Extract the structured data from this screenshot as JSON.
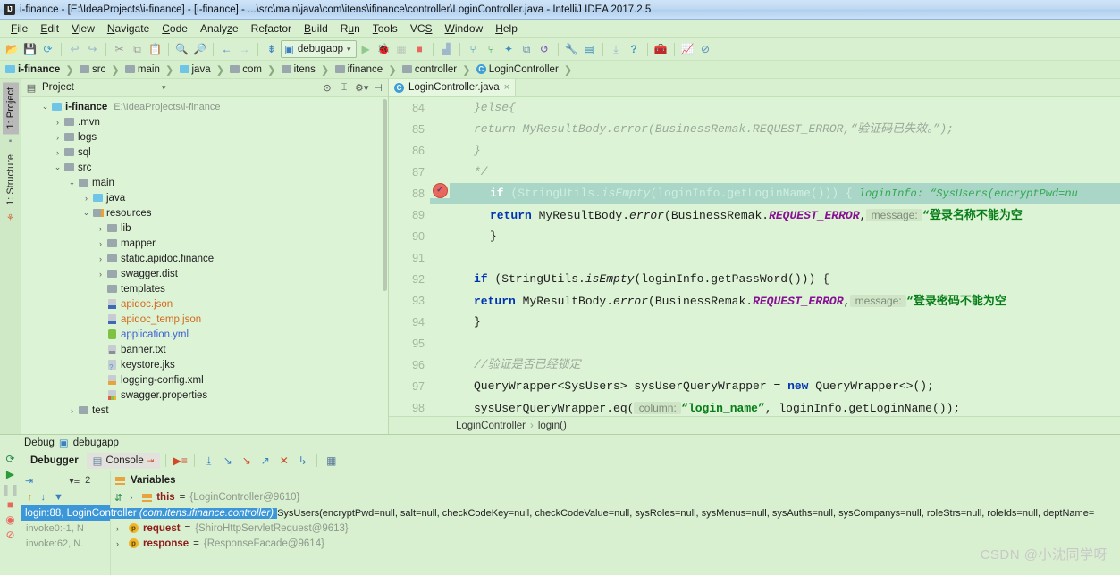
{
  "window": {
    "title": "i-finance - [E:\\IdeaProjects\\i-finance] - [i-finance] - ...\\src\\main\\java\\com\\itens\\ifinance\\controller\\LoginController.java - IntelliJ IDEA 2017.2.5",
    "logo": "IJ"
  },
  "menubar": [
    {
      "label": "File"
    },
    {
      "label": "Edit"
    },
    {
      "label": "View"
    },
    {
      "label": "Navigate"
    },
    {
      "label": "Code"
    },
    {
      "label": "Analyze"
    },
    {
      "label": "Refactor"
    },
    {
      "label": "Build"
    },
    {
      "label": "Run"
    },
    {
      "label": "Tools"
    },
    {
      "label": "VCS"
    },
    {
      "label": "Window"
    },
    {
      "label": "Help"
    }
  ],
  "toolbar": {
    "run_config": "debugapp",
    "icons": [
      "open-folder-icon",
      "save-all-icon",
      "sync-icon",
      "undo-icon",
      "redo-icon",
      "cut-icon",
      "copy-icon",
      "paste-icon",
      "find-icon",
      "replace-icon",
      "back-icon",
      "forward-icon",
      "compile-icon"
    ],
    "run_icons": [
      "run-icon",
      "debug-icon",
      "run-coverage-icon",
      "stop-icon",
      "profile-icon"
    ],
    "vcs_icons": [
      "update-project-icon",
      "commit-icon",
      "push-icon",
      "diff-icon",
      "rollback-icon"
    ],
    "right_icons": [
      "settings-icon",
      "project-structure-icon",
      "sdk-icon",
      "help-icon",
      "toolbox-icon",
      "monitor-icon",
      "no-access-icon"
    ]
  },
  "breadcrumbs": [
    {
      "label": "i-finance",
      "icon": "module-icon",
      "bold": true
    },
    {
      "label": "src",
      "icon": "folder-icon"
    },
    {
      "label": "main",
      "icon": "folder-icon"
    },
    {
      "label": "java",
      "icon": "source-folder-icon"
    },
    {
      "label": "com",
      "icon": "folder-icon"
    },
    {
      "label": "itens",
      "icon": "folder-icon"
    },
    {
      "label": "ifinance",
      "icon": "folder-icon"
    },
    {
      "label": "controller",
      "icon": "folder-icon"
    },
    {
      "label": "LoginController",
      "icon": "class-icon"
    }
  ],
  "left_strip": [
    {
      "label": "1: Project",
      "active": true
    },
    {
      "label": "1: Structure",
      "active": false
    }
  ],
  "project_panel": {
    "title": "Project",
    "header_icons": [
      "locate-icon",
      "collapse-all-icon",
      "gear-icon",
      "hide-icon"
    ],
    "tree": [
      {
        "indent": 0,
        "arrow": "down",
        "icon": "module-icon",
        "label": "i-finance",
        "bold": true,
        "path": "E:\\IdeaProjects\\i-finance"
      },
      {
        "indent": 1,
        "arrow": "right",
        "icon": "folder-icon",
        "label": ".mvn"
      },
      {
        "indent": 1,
        "arrow": "right",
        "icon": "folder-icon",
        "label": "logs"
      },
      {
        "indent": 1,
        "arrow": "right",
        "icon": "folder-icon",
        "label": "sql"
      },
      {
        "indent": 1,
        "arrow": "down",
        "icon": "folder-icon",
        "label": "src"
      },
      {
        "indent": 2,
        "arrow": "down",
        "icon": "folder-icon",
        "label": "main"
      },
      {
        "indent": 3,
        "arrow": "right",
        "icon": "source-folder-icon",
        "label": "java"
      },
      {
        "indent": 3,
        "arrow": "down",
        "icon": "resource-folder-icon",
        "label": "resources"
      },
      {
        "indent": 4,
        "arrow": "right",
        "icon": "folder-icon",
        "label": "lib"
      },
      {
        "indent": 4,
        "arrow": "right",
        "icon": "folder-icon",
        "label": "mapper"
      },
      {
        "indent": 4,
        "arrow": "right",
        "icon": "folder-icon",
        "label": "static.apidoc.finance"
      },
      {
        "indent": 4,
        "arrow": "right",
        "icon": "folder-icon",
        "label": "swagger.dist"
      },
      {
        "indent": 4,
        "arrow": "none",
        "icon": "folder-icon",
        "label": "templates"
      },
      {
        "indent": 4,
        "arrow": "none",
        "icon": "json-file-icon",
        "label": "apidoc.json",
        "color": "orange"
      },
      {
        "indent": 4,
        "arrow": "none",
        "icon": "json-file-icon",
        "label": "apidoc_temp.json",
        "color": "orange"
      },
      {
        "indent": 4,
        "arrow": "none",
        "icon": "yml-file-icon",
        "label": "application.yml",
        "color": "blue"
      },
      {
        "indent": 4,
        "arrow": "none",
        "icon": "txt-file-icon",
        "label": "banner.txt"
      },
      {
        "indent": 4,
        "arrow": "none",
        "icon": "jks-file-icon",
        "label": "keystore.jks"
      },
      {
        "indent": 4,
        "arrow": "none",
        "icon": "xml-file-icon",
        "label": "logging-config.xml"
      },
      {
        "indent": 4,
        "arrow": "none",
        "icon": "properties-file-icon",
        "label": "swagger.properties"
      },
      {
        "indent": 2,
        "arrow": "right",
        "icon": "folder-icon",
        "label": "test"
      }
    ]
  },
  "editor": {
    "tab": {
      "label": "LoginController.java",
      "icon": "class-icon",
      "close": "×"
    },
    "first_line": 84,
    "current_line": 88,
    "breakpoint_line": 88,
    "lines": [
      {
        "num": 84,
        "tokens": [
          {
            "t": "        }else{",
            "c": "cmt"
          }
        ]
      },
      {
        "num": 85,
        "tokens": [
          {
            "t": "            return MyResultBody.error(BusinessRemak.REQUEST_ERROR,“验证码已失效。”);",
            "c": "cmt"
          }
        ]
      },
      {
        "num": 86,
        "tokens": [
          {
            "t": "        }",
            "c": "cmt"
          }
        ]
      },
      {
        "num": 87,
        "tokens": [
          {
            "t": "        */",
            "c": "cmt"
          }
        ]
      },
      {
        "num": 88,
        "current": true,
        "breakpoint": true,
        "tokens": [
          {
            "t": "if ",
            "c": "kw-l"
          },
          {
            "t": "(StringUtils.",
            "c": "plain-l"
          },
          {
            "t": "isEmpty",
            "c": "mth-l"
          },
          {
            "t": "(loginInfo.getLoginName())) {",
            "c": "plain-l"
          },
          {
            "t": "  loginInfo:  “SysUsers(encryptPwd=nu",
            "c": "hint-inline"
          }
        ]
      },
      {
        "num": 89,
        "tokens": [
          {
            "t": "    return ",
            "c": "kw"
          },
          {
            "t": "MyResultBody.",
            "c": "plain"
          },
          {
            "t": "error",
            "c": "mth"
          },
          {
            "t": "(BusinessRemak.",
            "c": "plain"
          },
          {
            "t": "REQUEST_ERROR",
            "c": "cst"
          },
          {
            "t": ",",
            "c": "plain"
          },
          {
            "t": " message: ",
            "c": "hint"
          },
          {
            "t": "“登录名称不能为空",
            "c": "str"
          }
        ]
      },
      {
        "num": 90,
        "tokens": [
          {
            "t": "    }",
            "c": "plain"
          }
        ]
      },
      {
        "num": 91,
        "tokens": []
      },
      {
        "num": 92,
        "tokens": [
          {
            "t": "    if ",
            "c": "kw"
          },
          {
            "t": "(StringUtils.",
            "c": "plain"
          },
          {
            "t": "isEmpty",
            "c": "mth"
          },
          {
            "t": "(loginInfo.getPassWord())) {",
            "c": "plain"
          }
        ]
      },
      {
        "num": 93,
        "tokens": [
          {
            "t": "        return ",
            "c": "kw"
          },
          {
            "t": "MyResultBody.",
            "c": "plain"
          },
          {
            "t": "error",
            "c": "mth"
          },
          {
            "t": "(BusinessRemak.",
            "c": "plain"
          },
          {
            "t": "REQUEST_ERROR",
            "c": "cst"
          },
          {
            "t": ",",
            "c": "plain"
          },
          {
            "t": " message: ",
            "c": "hint"
          },
          {
            "t": "“登录密码不能为空",
            "c": "str"
          }
        ]
      },
      {
        "num": 94,
        "tokens": [
          {
            "t": "    }",
            "c": "plain"
          }
        ]
      },
      {
        "num": 95,
        "tokens": []
      },
      {
        "num": 96,
        "tokens": [
          {
            "t": "    //验证是否已经锁定",
            "c": "cmt"
          }
        ]
      },
      {
        "num": 97,
        "tokens": [
          {
            "t": "    QueryWrapper<SysUsers> sysUserQueryWrapper = ",
            "c": "plain"
          },
          {
            "t": "new ",
            "c": "kw"
          },
          {
            "t": "QueryWrapper<>();",
            "c": "plain"
          }
        ]
      },
      {
        "num": 98,
        "tokens": [
          {
            "t": "    sysUserQueryWrapper.eq(",
            "c": "plain"
          },
          {
            "t": " column: ",
            "c": "hint"
          },
          {
            "t": "“login_name”",
            "c": "str"
          },
          {
            "t": ", loginInfo.getLoginName());",
            "c": "plain"
          }
        ]
      }
    ],
    "status_breadcrumb": [
      {
        "label": "LoginController"
      },
      {
        "label": "login()"
      }
    ]
  },
  "debug": {
    "header": {
      "label": "Debug",
      "config": "debugapp",
      "icon": "debug-config-icon"
    },
    "side_icons": [
      "rerun-icon",
      "resume-icon",
      "pause-icon",
      "stop-icon",
      "view-breakpoints-icon",
      "mute-breakpoints-icon"
    ],
    "tabs": [
      {
        "label": "Debugger",
        "active": true
      },
      {
        "label": "Console",
        "active": false,
        "icon": "console-icon"
      }
    ],
    "step_icons": [
      "show-execution-point-icon",
      "step-over-icon",
      "step-into-icon",
      "force-step-into-icon",
      "step-out-icon",
      "drop-frame-icon",
      "run-to-cursor-icon",
      "evaluate-icon"
    ],
    "frames": {
      "header_icons": [
        "thread-icon",
        "frame-filter-icon"
      ],
      "thread_count": "2",
      "ctl_icons": [
        "up-icon",
        "down-icon",
        "filter-icon"
      ],
      "rows": [
        {
          "label": "login:88, LoginController",
          "pkg": "(com.itens.ifinance.controller)",
          "selected": true
        },
        {
          "label": "invoke0:-1, N",
          "selected": false
        },
        {
          "label": "invoke:62, N.",
          "selected": false
        }
      ]
    },
    "variables": {
      "title": "Variables",
      "ctl_icons": [
        "up-icon",
        "down-icon",
        "mute-icon"
      ],
      "rows": [
        {
          "arrow": "›",
          "badge": "lines",
          "name": "this",
          "eq": " = ",
          "value": "{LoginController@9610}"
        },
        {
          "arrow": "›",
          "badge": "p",
          "name": "request",
          "eq": " = ",
          "value": "{ShiroHttpServletRequest@9613}"
        },
        {
          "arrow": "›",
          "badge": "p",
          "name": "response",
          "eq": " = ",
          "value": "{ResponseFacade@9614}"
        }
      ],
      "overlay_value": "SysUsers(encryptPwd=null, salt=null, checkCodeKey=null, checkCodeValue=null, sysRoles=null, sysMenus=null, sysAuths=null, sysCompanys=null, roleStrs=null, roleIds=null, deptName=n"
    }
  },
  "watermark": "CSDN @小沈同学呀",
  "colors": {
    "editor_bg": "#ddf3d6",
    "panel_bg": "#d8f0d0",
    "current_line": "#a9d6c6",
    "selection_blue": "#3c97d9",
    "titlebar": "#bed8f2",
    "keyword": "#0033b3",
    "string": "#067d17",
    "constant": "#871094",
    "comment": "#9aa89a"
  }
}
